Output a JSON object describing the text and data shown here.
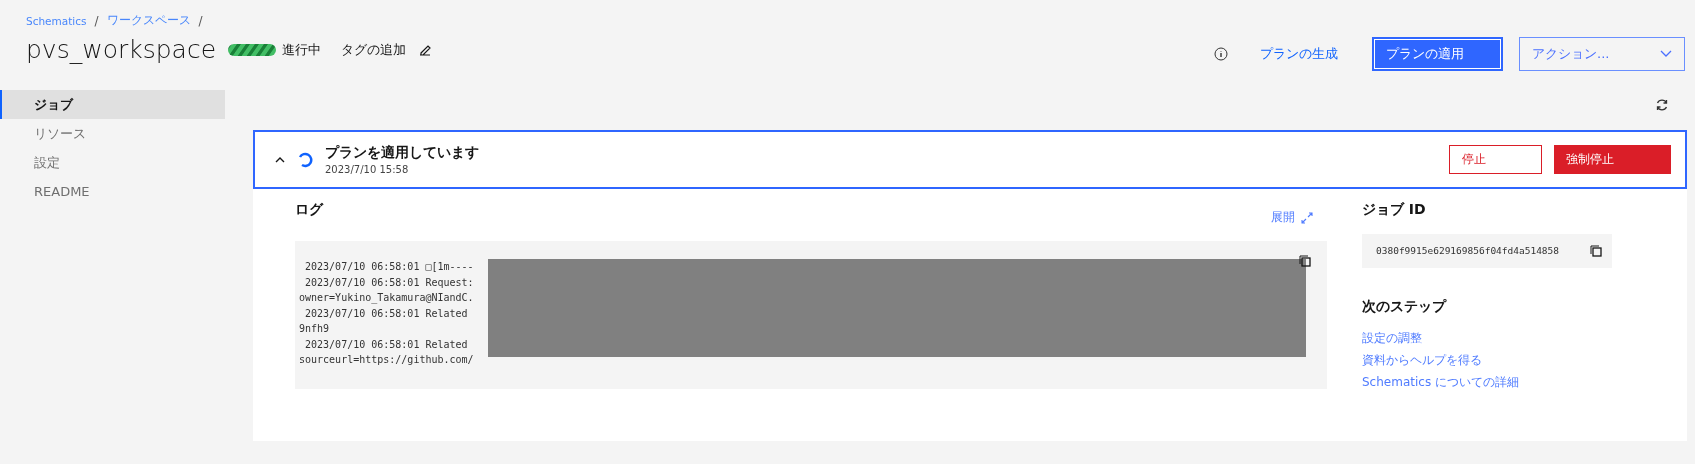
{
  "breadcrumb": [
    "Schematics",
    "ワークスペース"
  ],
  "breadcrumb_separator": "/",
  "title": "pvs_workspace",
  "status": {
    "label": "進行中",
    "kind": "in_progress"
  },
  "add_tag": "タグの追加",
  "actions": {
    "generate": "プランの生成",
    "apply": "プランの適用",
    "dropdown": "アクション..."
  },
  "sidebar": {
    "items": [
      {
        "label": "ジョブ",
        "selected": true
      },
      {
        "label": "リソース",
        "selected": false
      },
      {
        "label": "設定",
        "selected": false
      },
      {
        "label": "README",
        "selected": false
      }
    ]
  },
  "job": {
    "expanded": true,
    "title": "プランを適用しています",
    "time": "2023/7/10 15:58",
    "stop": "停止",
    "force_stop": "強制停止",
    "log_title": "ログ",
    "expand": "展開",
    "log_lines": [
      " 2023/07/10 06:58:01 □[1m----",
      " 2023/07/10 06:58:01 Request:",
      "owner=Yukino_Takamura@NIandC.",
      " 2023/07/10 06:58:01 Related",
      "9nfh9",
      " 2023/07/10 06:58:01 Related",
      "sourceurl=https://github.com/"
    ],
    "job_id_title": "ジョブ ID",
    "job_id": "0380f9915e629169856f04fd4a514858",
    "next_title": "次のステップ",
    "next_links": [
      "設定の調整",
      "資料からヘルプを得る",
      "Schematics についての詳細"
    ]
  }
}
